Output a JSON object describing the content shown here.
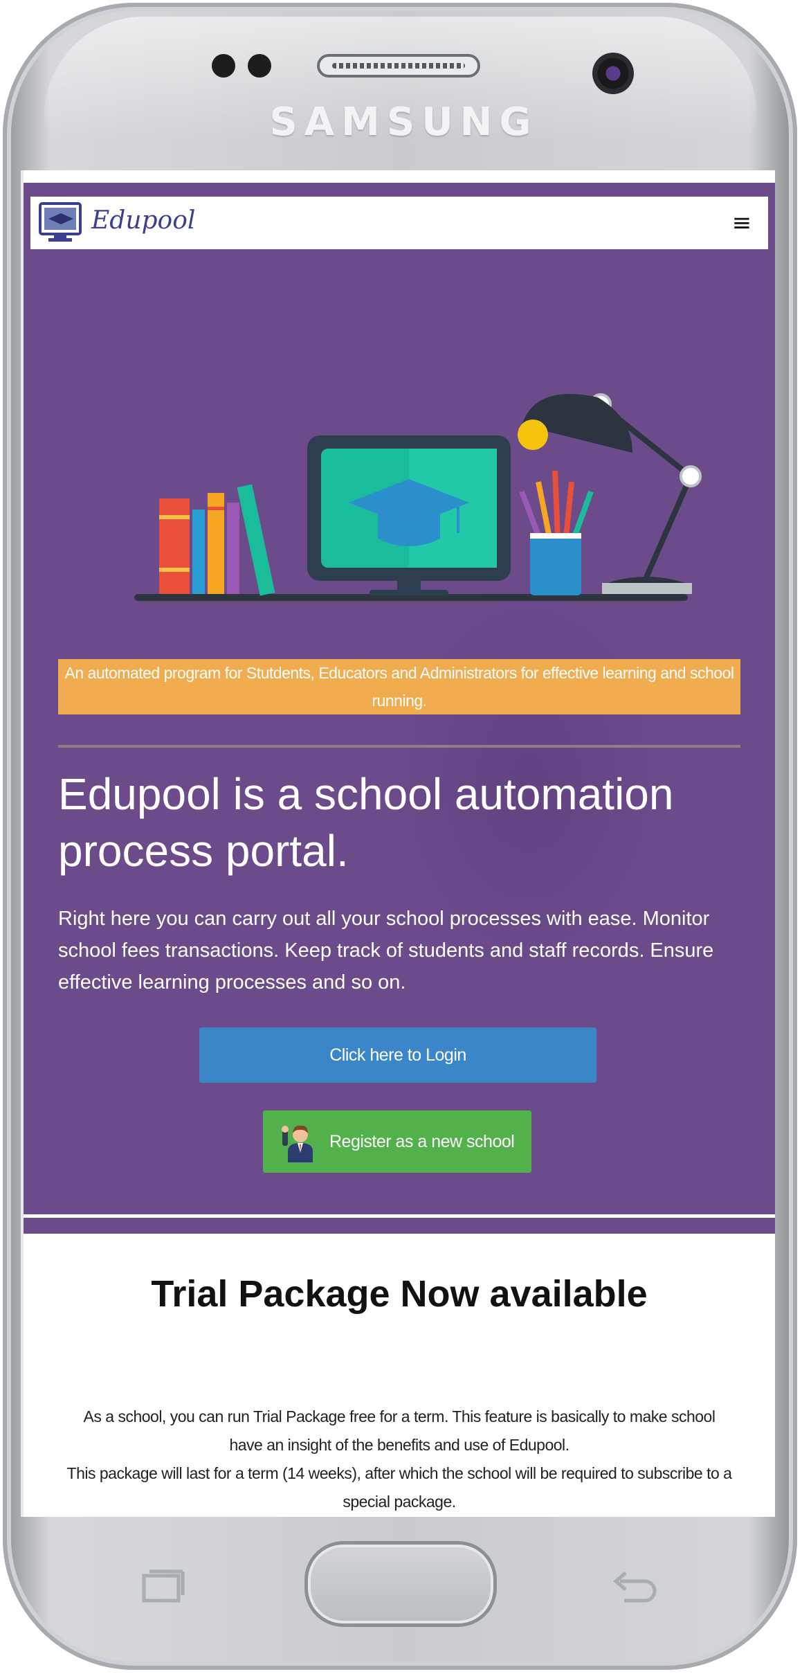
{
  "device": {
    "brand_label": "SAMSUNG"
  },
  "navbar": {
    "logo_text": "Edupool",
    "menu_icon": "hamburger-menu-icon",
    "menu_glyph": "≡"
  },
  "hero": {
    "tagline": "An automated program for Stutdents, Educators and Administrators for effective learning and school running.",
    "headline": "Edupool is a school automation process portal.",
    "lead": "Right here you can carry out all your school processes with ease. Monitor school fees transactions. Keep track of students and staff records. Ensure effective learning processes and so on.",
    "login_button": "Click here to Login",
    "register_button": "Register as a new school"
  },
  "trial": {
    "title": "Trial Package Now available",
    "line1": "As a school, you can run Trial Package free for a term. This feature is basically to make school have an insight of the benefits and use of Edupool.",
    "line2": "This package will last for a term (14 weeks), after which the school will be required to subscribe to a special package."
  },
  "colors": {
    "hero_bg": "#6c4b8b",
    "tagline_bg": "#f0ac4e",
    "login_bg": "#3a86c8",
    "register_bg": "#52b14a"
  }
}
